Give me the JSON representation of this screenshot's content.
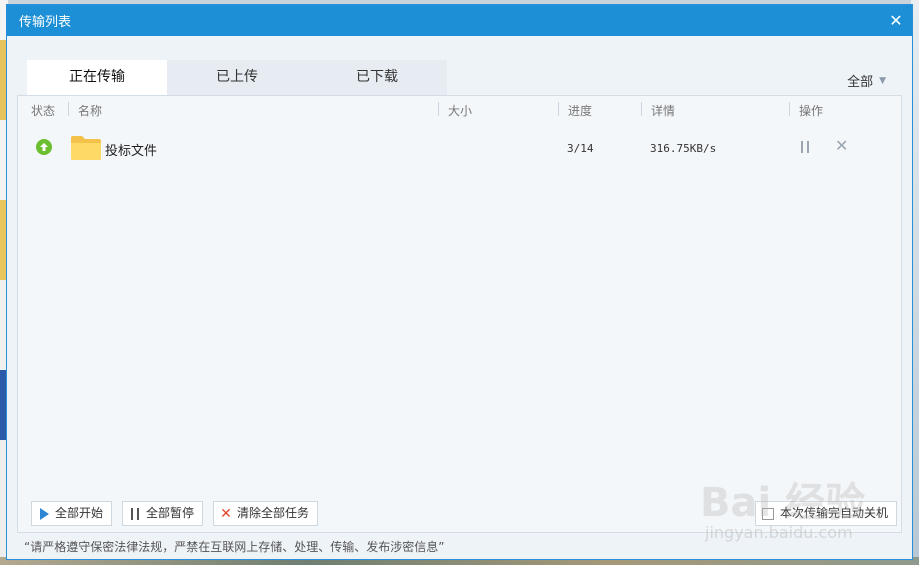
{
  "window": {
    "title": "传输列表"
  },
  "tabs": [
    {
      "label": "正在传输",
      "active": true
    },
    {
      "label": "已上传",
      "active": false
    },
    {
      "label": "已下载",
      "active": false
    }
  ],
  "filter": {
    "label": "全部"
  },
  "columns": [
    "状态",
    "名称",
    "大小",
    "进度",
    "详情",
    "操作"
  ],
  "rows": [
    {
      "name": "投标文件",
      "size": "",
      "progress": "3/14",
      "detail": "316.75KB/s"
    }
  ],
  "buttons": {
    "start_all": "全部开始",
    "pause_all": "全部暂停",
    "clear_all": "清除全部任务",
    "shutdown": "本次传输完自动关机"
  },
  "notice": "“请严格遵守保密法律法规，严禁在互联网上存储、处理、传输、发布涉密信息”",
  "watermark": {
    "text": "Bai 经验",
    "sub": "jingyan.baidu.com"
  },
  "colors": {
    "titlebar": "#1c8fd6",
    "status_ok": "#6cbf2e",
    "clear_icon": "#e2462c",
    "start_icon": "#2d86d3"
  }
}
